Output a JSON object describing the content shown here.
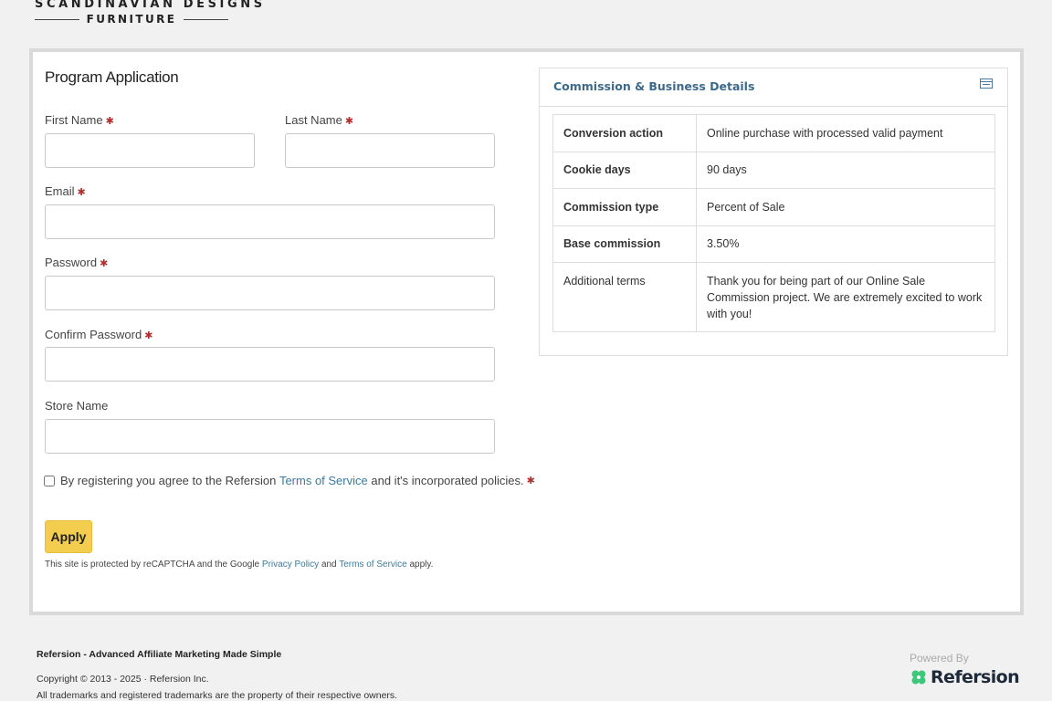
{
  "brand": {
    "line1": "SCANDINAVIAN DESIGNS",
    "line2": "FURNITURE"
  },
  "form": {
    "title": "Program Application",
    "first_name_label": "First Name",
    "last_name_label": "Last Name",
    "email_label": "Email",
    "password_label": "Password",
    "confirm_password_label": "Confirm Password",
    "store_name_label": "Store Name",
    "required_mark": "✱",
    "terms_prefix": "By registering you agree to the Refersion",
    "terms_link": "Terms of Service",
    "terms_suffix": "and it's incorporated policies.",
    "apply_label": "Apply",
    "recaptcha_prefix": "This site is protected by reCAPTCHA and the Google",
    "privacy_link": "Privacy Policy",
    "recaptcha_and": "and",
    "recaptcha_terms_link": "Terms of Service",
    "recaptcha_suffix": "apply."
  },
  "details": {
    "title": "Commission & Business Details",
    "icon": "id-card-icon",
    "rows": [
      {
        "key": "Conversion action",
        "value": "Online purchase with processed valid payment"
      },
      {
        "key": "Cookie days",
        "value": "90 days"
      },
      {
        "key": "Commission type",
        "value": "Percent of Sale"
      },
      {
        "key": "Base commission",
        "value": "3.50%"
      },
      {
        "key": "Additional terms",
        "value": "Thank you for being part of our Online Sale Commission project. We are extremely excited to work with you!"
      }
    ]
  },
  "footer": {
    "title": "Refersion - Advanced Affiliate Marketing Made Simple",
    "copyright": "Copyright © 2013 - 2025 · Refersion Inc.",
    "trademarks": "All trademarks and registered trademarks are the property of their respective owners.",
    "powered_by": "Powered By",
    "logo_name": "Refersion"
  },
  "colors": {
    "accent_button": "#f2cd4e",
    "link": "#3c7a9c",
    "required": "#b03030",
    "panel_title": "#3d6a8a",
    "logo_green": "#3cc87a"
  }
}
